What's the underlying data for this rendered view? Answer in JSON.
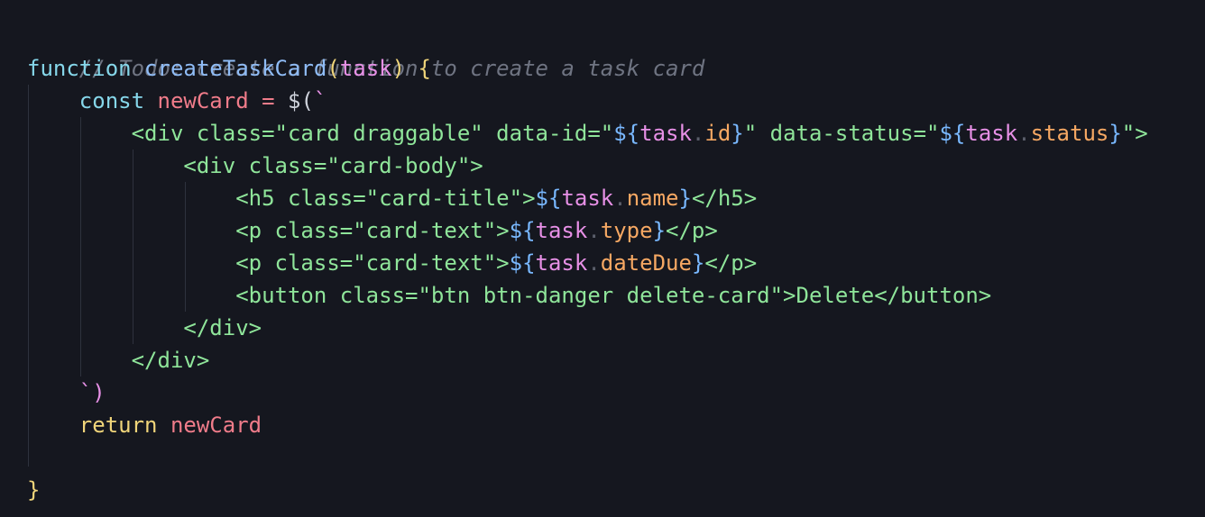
{
  "code": {
    "comment": "// Todo: create a function to create a task card",
    "l2": {
      "kw": "function",
      "fn": "createTaskCard",
      "open": "(",
      "param": "task",
      "close": ")",
      "brace": "{"
    },
    "l3": {
      "kw": "const",
      "var": "newCard",
      "op": "=",
      "call": "$(",
      "tick": "`"
    },
    "l4": {
      "a": "<div class=\"card draggable\" data-id=\"",
      "i1": "${",
      "obj1": "task",
      "dot1": ".",
      "p1": "id",
      "e1": "}",
      "b": "\" data-status=\"",
      "i2": "${",
      "obj2": "task",
      "dot2": ".",
      "p2": "status",
      "e2": "}",
      "c": "\">"
    },
    "l5": {
      "a": "<div class=\"card-body\">"
    },
    "l6": {
      "a": "<h5 class=\"card-title\">",
      "i": "${",
      "obj": "task",
      "dot": ".",
      "p": "name",
      "e": "}",
      "b": "</h5>"
    },
    "l7": {
      "a": "<p class=\"card-text\">",
      "i": "${",
      "obj": "task",
      "dot": ".",
      "p": "type",
      "e": "}",
      "b": "</p>"
    },
    "l8": {
      "a": "<p class=\"card-text\">",
      "i": "${",
      "obj": "task",
      "dot": ".",
      "p": "dateDue",
      "e": "}",
      "b": "</p>"
    },
    "l9": {
      "a": "<button class=\"btn btn-danger delete-card\">Delete</button>"
    },
    "l10": {
      "a": "</div>"
    },
    "l11": {
      "a": "</div>"
    },
    "l12": {
      "tick": "`",
      "close": ")"
    },
    "l13": {
      "kw": "return",
      "var": "newCard"
    },
    "l15": {
      "brace": "}"
    }
  },
  "colors": {
    "background": "#15171f",
    "comment": "#6f7482",
    "keyword": "#86d7ea",
    "function": "#8fbcf6",
    "string": "#8fe59a",
    "variable": "#f07c8a",
    "property": "#f6a863"
  }
}
